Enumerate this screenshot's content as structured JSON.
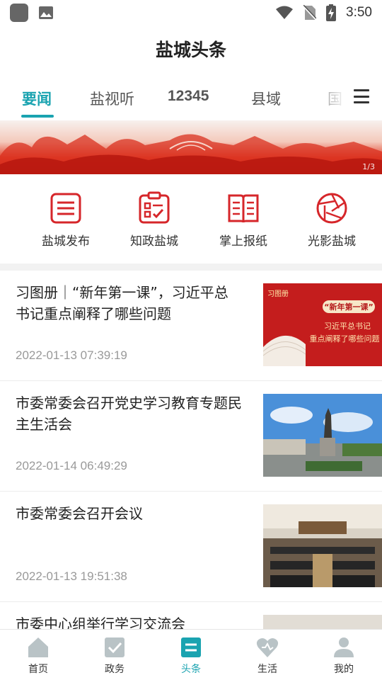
{
  "status_bar": {
    "time": "3:50"
  },
  "header": {
    "title": "盐城头条"
  },
  "tabs": [
    {
      "label": "要闻",
      "active": true
    },
    {
      "label": "盐视听",
      "active": false
    },
    {
      "label": "12345",
      "active": false
    },
    {
      "label": "县域",
      "active": false
    },
    {
      "label": "国",
      "active": false
    }
  ],
  "banner": {
    "indicator": "1/3"
  },
  "quick_entries": [
    {
      "label": "盐城发布",
      "icon": "list-document-icon"
    },
    {
      "label": "知政盐城",
      "icon": "clipboard-check-icon"
    },
    {
      "label": "掌上报纸",
      "icon": "open-newspaper-icon"
    },
    {
      "label": "光影盐城",
      "icon": "camera-aperture-icon"
    }
  ],
  "news": [
    {
      "title": "习图册｜“新年第一课”，习近平总书记重点阐释了哪些问题",
      "date": "2022-01-13 07:39:19",
      "thumb_brand": "习图册",
      "thumb_headline": "“新年第一课”",
      "thumb_sub1": "习近平总书记",
      "thumb_sub2": "重点阐释了哪些问题"
    },
    {
      "title": "市委常委会召开党史学习教育专题民主生活会",
      "date": "2022-01-14 06:49:29"
    },
    {
      "title": "市委常委会召开会议",
      "date": "2022-01-13 19:51:38"
    },
    {
      "title": "市委中心组举行学习交流会",
      "date": ""
    }
  ],
  "bottom_nav": [
    {
      "label": "首页",
      "icon": "home-icon",
      "active": false
    },
    {
      "label": "政务",
      "icon": "checkbox-icon",
      "active": false
    },
    {
      "label": "头条",
      "icon": "headline-icon",
      "active": true
    },
    {
      "label": "生活",
      "icon": "heart-icon",
      "active": false
    },
    {
      "label": "我的",
      "icon": "user-icon",
      "active": false
    }
  ],
  "colors": {
    "accent": "#1aa3b0",
    "brand_red": "#d6262a",
    "inactive_icon": "#b9c3c6"
  }
}
